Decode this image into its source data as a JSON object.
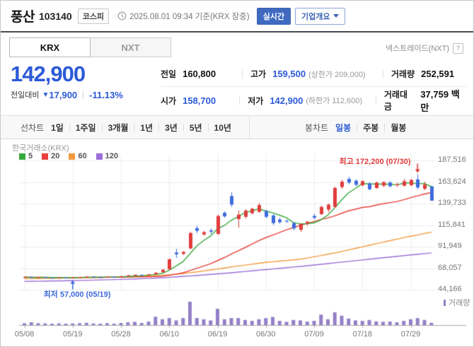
{
  "header": {
    "stock_name": "풍산",
    "stock_code": "103140",
    "market_badge": "코스피",
    "timestamp": "2025.08.01 09:34 기준(KRX 장중)",
    "realtime_button": "실시간",
    "company_overview_button": "기업개요"
  },
  "tabs": {
    "krx": "KRX",
    "nxt": "NXT",
    "nextrade_note": "넥스트레이드(NXT)",
    "help_icon": "?"
  },
  "price": {
    "current": "142,900",
    "change_label": "전일대비",
    "change_arrow": "▼",
    "change_value": "17,900",
    "change_percent": "-11.13%",
    "direction": "down",
    "accent_blue": "#2b5ad8"
  },
  "summary": {
    "rows": [
      [
        {
          "label": "전일",
          "value": "160,800",
          "value_color": "black"
        },
        {
          "label": "고가",
          "value": "159,500",
          "extra": "(상한가 209,000)",
          "value_color": "blue"
        },
        {
          "label": "거래량",
          "value": "252,591",
          "value_color": "black"
        }
      ],
      [
        {
          "label": "시가",
          "value": "158,700",
          "value_color": "blue"
        },
        {
          "label": "저가",
          "value": "142,900",
          "extra": "(하한가 112,600)",
          "value_color": "blue"
        },
        {
          "label": "거래대금",
          "value": "37,759 백만",
          "value_color": "black"
        }
      ]
    ]
  },
  "toolbar": {
    "line_chart_label": "선차트",
    "periods": [
      "1일",
      "1주일",
      "3개월",
      "1년",
      "3년",
      "5년",
      "10년"
    ],
    "candle_chart_label": "봉차트",
    "candle_periods": [
      "일봉",
      "주봉",
      "월봉"
    ],
    "active_candle_period": "일봉"
  },
  "chart_data": {
    "type": "candlestick",
    "exchange_label": "한국거래소(KRX)",
    "ma_legend": [
      {
        "period": "5",
        "color": "#36a93c"
      },
      {
        "period": "20",
        "color": "#e8403c"
      },
      {
        "period": "60",
        "color": "#f2993c"
      },
      {
        "period": "120",
        "color": "#9b6dd6"
      }
    ],
    "volume_legend": "거래량",
    "y_axis_labels": [
      "187,516",
      "163,624",
      "139,733",
      "115,841",
      "91,949",
      "68,057",
      "44,166"
    ],
    "y_axis_values": [
      187516,
      163624,
      139733,
      115841,
      91949,
      68057,
      44166
    ],
    "x_axis_labels": [
      "05/08",
      "05/19",
      "05/28",
      "06/10",
      "06/19",
      "06/30",
      "07/09",
      "07/18",
      "07/29"
    ],
    "tick_day_indices": [
      0,
      7,
      14,
      21,
      28,
      35,
      42,
      49,
      56
    ],
    "annotations": {
      "high": {
        "label": "최고 172,200 (07/30)",
        "value": 172200,
        "date": "07/30",
        "day_index": 57,
        "color": "#e03c3c"
      },
      "low": {
        "label": "최저 57,000 (05/19)",
        "value": 57000,
        "date": "05/19",
        "day_index": 7,
        "color": "#3e6bdc"
      }
    },
    "dates": [
      "05/08",
      "05/09",
      "05/12",
      "05/13",
      "05/14",
      "05/15",
      "05/16",
      "05/19",
      "05/20",
      "05/21",
      "05/22",
      "05/23",
      "05/26",
      "05/27",
      "05/28",
      "05/29",
      "05/30",
      "06/02",
      "06/04",
      "06/05",
      "06/09",
      "06/10",
      "06/11",
      "06/12",
      "06/13",
      "06/16",
      "06/17",
      "06/18",
      "06/19",
      "06/20",
      "06/23",
      "06/24",
      "06/25",
      "06/26",
      "06/27",
      "06/30",
      "07/01",
      "07/02",
      "07/03",
      "07/04",
      "07/07",
      "07/08",
      "07/09",
      "07/10",
      "07/11",
      "07/14",
      "07/15",
      "07/16",
      "07/17",
      "07/18",
      "07/21",
      "07/22",
      "07/23",
      "07/24",
      "07/25",
      "07/28",
      "07/29",
      "07/30",
      "07/31",
      "08/01"
    ],
    "candles": [
      [
        57800,
        58600,
        57300,
        58300
      ],
      [
        58400,
        58700,
        57200,
        57400
      ],
      [
        57500,
        58300,
        57300,
        58100
      ],
      [
        58100,
        58400,
        57300,
        57500
      ],
      [
        57600,
        57900,
        57100,
        57300
      ],
      [
        57200,
        58000,
        57100,
        57800
      ],
      [
        57800,
        58000,
        57200,
        57400
      ],
      [
        57500,
        57900,
        57000,
        57700
      ],
      [
        57700,
        58500,
        57400,
        58300
      ],
      [
        58300,
        59000,
        58100,
        58800
      ],
      [
        58800,
        59000,
        58000,
        58200
      ],
      [
        58200,
        58500,
        57700,
        57900
      ],
      [
        58000,
        58900,
        57800,
        58700
      ],
      [
        58700,
        58900,
        58000,
        58200
      ],
      [
        58300,
        59400,
        58100,
        59200
      ],
      [
        59300,
        60500,
        59000,
        60200
      ],
      [
        60200,
        61100,
        59600,
        60800
      ],
      [
        60700,
        61100,
        59900,
        60200
      ],
      [
        60300,
        61600,
        60100,
        61300
      ],
      [
        61400,
        63500,
        61100,
        63100
      ],
      [
        63600,
        67000,
        63300,
        66400
      ],
      [
        66800,
        78500,
        66300,
        78000
      ],
      [
        85500,
        89500,
        79500,
        83500
      ],
      [
        84000,
        87000,
        82500,
        86000
      ],
      [
        90000,
        108500,
        89000,
        107000
      ],
      [
        112500,
        115000,
        107000,
        109500
      ],
      [
        105500,
        109500,
        104000,
        108000
      ],
      [
        110000,
        112000,
        106000,
        108500
      ],
      [
        106000,
        127500,
        105000,
        126000
      ],
      [
        129500,
        131000,
        124000,
        125500
      ],
      [
        148000,
        152000,
        136000,
        138500
      ],
      [
        122500,
        132000,
        113000,
        127500
      ],
      [
        125000,
        133500,
        123000,
        132000
      ],
      [
        129000,
        135000,
        127500,
        134000
      ],
      [
        130500,
        140500,
        129500,
        138000
      ],
      [
        131500,
        133000,
        123500,
        125000
      ],
      [
        126500,
        128000,
        116000,
        118000
      ],
      [
        122000,
        124000,
        117500,
        119000
      ],
      [
        120500,
        122000,
        118500,
        119500
      ],
      [
        118000,
        119000,
        110000,
        112000
      ],
      [
        110500,
        118000,
        108500,
        117000
      ],
      [
        117500,
        120500,
        115000,
        119500
      ],
      [
        126000,
        128500,
        122000,
        124000
      ],
      [
        128000,
        137500,
        127000,
        136000
      ],
      [
        133000,
        140000,
        130000,
        138500
      ],
      [
        136000,
        158500,
        135000,
        157000
      ],
      [
        158000,
        166000,
        156000,
        164000
      ],
      [
        167000,
        169500,
        161000,
        163000
      ],
      [
        165000,
        166500,
        159000,
        160500
      ],
      [
        160000,
        165500,
        158500,
        164500
      ],
      [
        162000,
        163500,
        154500,
        155500
      ],
      [
        157000,
        164000,
        156000,
        163000
      ],
      [
        159500,
        164500,
        158000,
        163500
      ],
      [
        163000,
        164500,
        157500,
        159000
      ],
      [
        160500,
        163000,
        158000,
        161000
      ],
      [
        159500,
        167000,
        158500,
        164500
      ],
      [
        160000,
        166500,
        159000,
        166000
      ],
      [
        166500,
        172200,
        155500,
        157500
      ],
      [
        156000,
        164000,
        154500,
        160800
      ],
      [
        158700,
        159500,
        142900,
        142900
      ]
    ],
    "volumes": [
      8,
      12,
      8,
      7,
      6,
      7,
      5,
      7,
      8,
      10,
      7,
      6,
      8,
      6,
      9,
      12,
      14,
      9,
      15,
      36,
      25,
      30,
      20,
      30,
      100,
      30,
      25,
      20,
      70,
      25,
      30,
      30,
      22,
      18,
      25,
      30,
      35,
      18,
      14,
      22,
      20,
      15,
      18,
      45,
      25,
      55,
      40,
      28,
      20,
      18,
      22,
      16,
      14,
      15,
      12,
      18,
      25,
      30,
      22,
      10
    ],
    "ma60": [
      56500,
      56600,
      56700,
      56800,
      56900,
      57000,
      57150,
      57300,
      57450,
      57600,
      57700,
      57850,
      58000,
      58200,
      58350,
      58500,
      58800,
      59100,
      59400,
      59700,
      60000,
      60700,
      61400,
      62200,
      63100,
      64000,
      65000,
      66100,
      67200,
      68300,
      69500,
      70500,
      71500,
      72500,
      73500,
      74500,
      75200,
      75900,
      76600,
      77300,
      78000,
      79300,
      80700,
      82100,
      83500,
      85000,
      86600,
      88300,
      90000,
      91700,
      93500,
      95200,
      96900,
      98600,
      100300,
      102000,
      103500,
      105000,
      106500,
      108000
    ],
    "ma120": [
      53500,
      53600,
      53700,
      53800,
      53900,
      54000,
      54150,
      54300,
      54450,
      54650,
      54800,
      55000,
      55200,
      55400,
      55600,
      55800,
      56100,
      56400,
      56800,
      57100,
      57500,
      58000,
      58500,
      59000,
      59500,
      60000,
      60600,
      61200,
      61800,
      62400,
      63000,
      63700,
      64400,
      65100,
      65800,
      66500,
      67200,
      67900,
      68600,
      69300,
      70000,
      70800,
      71600,
      72400,
      73200,
      74000,
      74800,
      75600,
      76400,
      77200,
      78000,
      78800,
      79600,
      80400,
      81200,
      82000,
      82750,
      83500,
      84250,
      85000
    ],
    "colors": {
      "up": "#e03c3c",
      "down": "#3e6bdc",
      "ma5": "#36a93c",
      "ma20": "#e8403c",
      "ma60": "#f2993c",
      "ma120": "#9b6dd6",
      "volume": "#9480c8",
      "grid": "#ececec",
      "axis": "#aaaaaa"
    }
  }
}
